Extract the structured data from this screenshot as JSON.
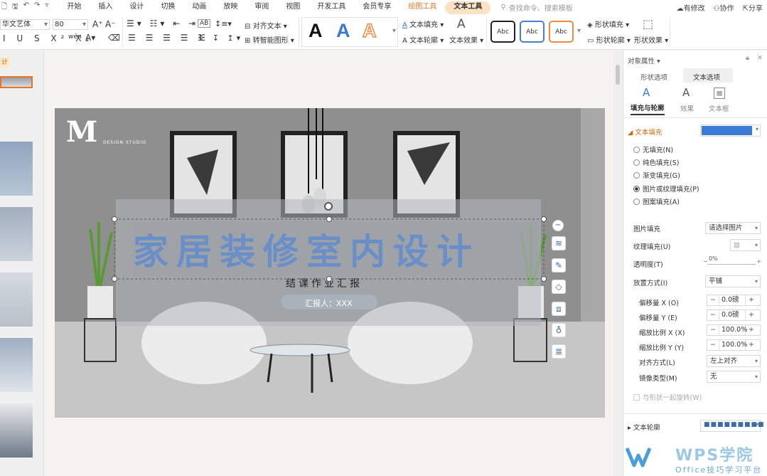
{
  "menu": {
    "quick_icons": [
      "file-icon",
      "save-icon",
      "undo-icon",
      "redo-icon",
      "more-icon"
    ],
    "tabs": [
      "开始",
      "插入",
      "设计",
      "切换",
      "动画",
      "放映",
      "审阅",
      "视图",
      "开发工具",
      "会员专享"
    ],
    "context_tab_drawing": "绘图工具",
    "context_tab_text": "文本工具",
    "search_placeholder": "查找命令、搜索模板",
    "right": {
      "changes": "有修改",
      "collab": "协作",
      "share": "分享"
    }
  },
  "ribbon": {
    "font_name": "华文艺体",
    "font_size": "80",
    "align_text": "对齐文本",
    "smart_art": "转智能图形",
    "text_fill": "文本填充",
    "text_outline": "文本轮廓",
    "text_effect": "文本效果",
    "style_letter": "A",
    "shape_fill": "形状填充",
    "shape_outline": "形状轮廓",
    "shape_effect": "形状效果",
    "abc_label": "Abc"
  },
  "thumbnails": {
    "header": "计",
    "items": [
      "slide-1",
      "slide-2",
      "slide-3",
      "slide-4",
      "slide-5",
      "slide-6"
    ],
    "selected_text": "设计"
  },
  "slide": {
    "logo_letter": "M",
    "logo_sub": "DESIGN STUDIO",
    "title": "家居装修室内设计",
    "subtitle": "结课作业汇报",
    "presenter": "汇报人：XXX"
  },
  "panel": {
    "header": "对象属性",
    "tabs": [
      "形状选项",
      "文本选项"
    ],
    "subtabs": [
      "填充与轮廓",
      "效果",
      "文本框"
    ],
    "text_fill_section": "文本填充",
    "fill_color": "#3a7bd5",
    "fill_options": [
      "无填充(N)",
      "纯色填充(S)",
      "渐变填充(G)",
      "图片或纹理填充(P)",
      "图案填充(A)"
    ],
    "fill_selected_index": 3,
    "picture_fill_label": "图片填充",
    "picture_fill_value": "请选择图片",
    "texture_fill_label": "纹理填充(U)",
    "transparency_label": "透明度(T)",
    "transparency_value": "0%",
    "placement_label": "放置方式(I)",
    "placement_value": "平铺",
    "offset_x_label": "偏移量 X (O)",
    "offset_x_value": "0.0磅",
    "offset_y_label": "偏移量 Y (E)",
    "offset_y_value": "0.0磅",
    "scale_x_label": "缩放比例 X (X)",
    "scale_x_value": "100.0%",
    "scale_y_label": "缩放比例 Y (Y)",
    "scale_y_value": "100.0%",
    "align_label": "对齐方式(L)",
    "align_value": "左上对齐",
    "mirror_label": "镜像类型(M)",
    "mirror_value": "无",
    "rotate_with_shape": "与形状一起旋转(W)",
    "text_outline_section": "文本轮廓"
  },
  "watermark": {
    "brand": "WPS学院",
    "tagline": "Office技巧学习平台"
  },
  "colors": {
    "accent": "#e8742a",
    "title_blue": "#6a8fc8",
    "wps_blue": "#4a9fd8"
  }
}
